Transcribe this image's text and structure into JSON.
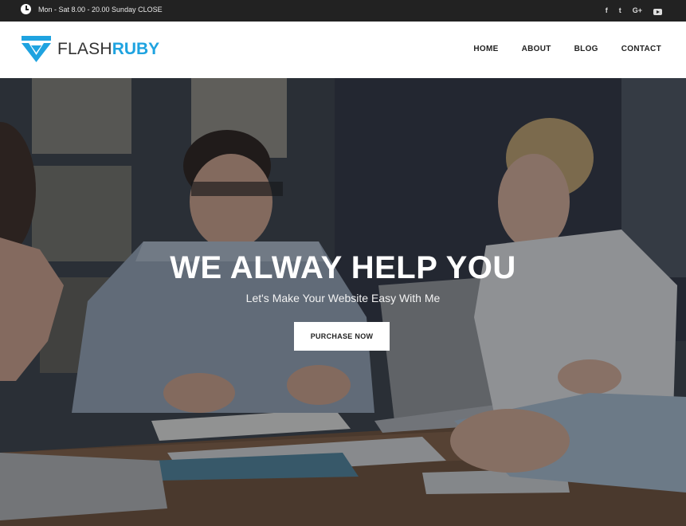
{
  "topbar": {
    "hours": "Mon - Sat 8.00 - 20.00 Sunday CLOSE",
    "clock_icon": "clock-icon",
    "social": [
      {
        "name": "facebook-icon",
        "glyph": "f"
      },
      {
        "name": "twitter-icon",
        "glyph": "t"
      },
      {
        "name": "google-plus-icon",
        "glyph": "G+"
      },
      {
        "name": "youtube-icon",
        "glyph": ""
      }
    ]
  },
  "header": {
    "logo_part1": "FLASH",
    "logo_part2": "RUBY",
    "logo_color": "#1fa3e0",
    "nav": [
      "HOME",
      "ABOUT",
      "BLOG",
      "CONTACT"
    ]
  },
  "hero": {
    "title": "WE ALWAY HELP YOU",
    "subtitle": "Let's Make Your Website Easy With Me",
    "button_label": "PURCHASE NOW"
  }
}
